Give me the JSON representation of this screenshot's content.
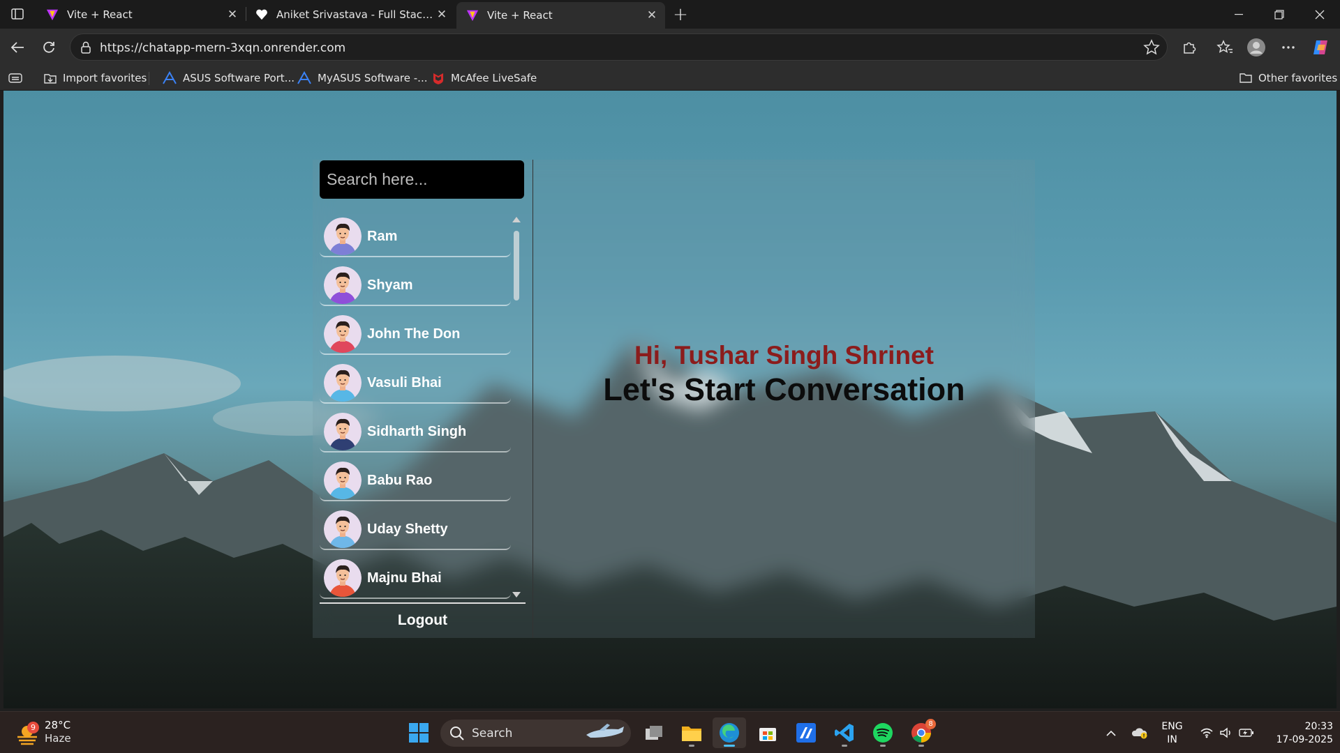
{
  "browser": {
    "tabs": [
      {
        "title": "Vite + React",
        "favicon": "vite-icon",
        "active": false
      },
      {
        "title": "Aniket Srivastava - Full Stack Developer",
        "favicon": "heart-icon",
        "active": false
      },
      {
        "title": "Vite + React",
        "favicon": "vite-icon",
        "active": true
      }
    ],
    "url": "https://chatapp-mern-3xqn.onrender.com",
    "favorites": [
      {
        "label": "Import favorites",
        "icon": "import-icon"
      },
      {
        "label": "ASUS Software Port...",
        "icon": "asus-icon"
      },
      {
        "label": "MyASUS Software -...",
        "icon": "asus-icon"
      },
      {
        "label": "McAfee LiveSafe",
        "icon": "mcafee-icon"
      }
    ],
    "other_favorites": "Other favorites"
  },
  "chat_app": {
    "search_placeholder": "Search here...",
    "contacts": [
      {
        "name": "Ram",
        "avatar_color": "#7d7fd6"
      },
      {
        "name": "Shyam",
        "avatar_color": "#8f4fd9"
      },
      {
        "name": "John The Don",
        "avatar_color": "#e0475c"
      },
      {
        "name": "Vasuli Bhai",
        "avatar_color": "#57b7e6"
      },
      {
        "name": "Sidharth Singh",
        "avatar_color": "#2f3f73"
      },
      {
        "name": "Babu Rao",
        "avatar_color": "#57b7e6"
      },
      {
        "name": "Uday Shetty",
        "avatar_color": "#6fb7e8"
      },
      {
        "name": "Majnu Bhai",
        "avatar_color": "#e8553a"
      }
    ],
    "logout_label": "Logout",
    "greeting": "Hi, Tushar Singh Shrinet",
    "tagline": "Let's Start Conversation"
  },
  "taskbar": {
    "weather": {
      "temp": "28°C",
      "condition": "Haze",
      "badge": "9"
    },
    "search_label": "Search",
    "language": {
      "line1": "ENG",
      "line2": "IN"
    },
    "time": "20:33",
    "date": "17-09-2025",
    "chrome_badge": "8"
  }
}
